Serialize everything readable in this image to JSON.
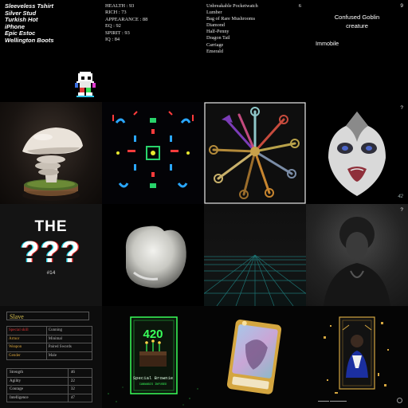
{
  "tiles": {
    "items": [
      "Sleeveless Tshirt",
      "Silver Stud",
      "Turkish Hot",
      "iPhone",
      "Epic Estoc",
      "Wellington Boots"
    ],
    "stats": [
      "HEALTH : 93",
      "RICH : 73",
      "APPEARANCE : 88",
      "EQ : 92",
      "SPIRIT : 93",
      "IQ : 84"
    ],
    "loot": {
      "number": "6",
      "items": [
        "Unbreakable Pocketwatch",
        "Lumber",
        "Bag of Rare Mushrooms",
        "Diamond",
        "Half-Penny",
        "Dragon Tail",
        "Carriage",
        "Emerald"
      ]
    },
    "goblin": {
      "number": "9",
      "name": "Confused Goblin",
      "type": "creature",
      "status": "Immobile"
    },
    "mask": {
      "top_number": "?",
      "bottom_number": "42"
    },
    "the": {
      "top": "THE",
      "marks": "???",
      "number": "#14"
    },
    "portrait": {
      "top_number": "?"
    },
    "card": {
      "title": "Slave",
      "attributes": [
        {
          "label": "Special skill",
          "value": "Cunning"
        },
        {
          "label": "Armor",
          "value": "Minimal"
        },
        {
          "label": "Weapon",
          "value": "Paired Swords"
        },
        {
          "label": "Gender",
          "value": "Male"
        }
      ],
      "stats": [
        {
          "label": "Strength",
          "value": "46"
        },
        {
          "label": "Agility",
          "value": "22"
        },
        {
          "label": "Courage",
          "value": "32"
        },
        {
          "label": "Intelligence",
          "value": "47"
        }
      ]
    },
    "brownie": {
      "badge": "420",
      "name": "Special Brownie",
      "subtitle": "CANNABIS INFUSED"
    }
  },
  "colors": {
    "background": "#000000",
    "card_gold": "#d9c253",
    "card_red": "#dd3333",
    "neon_green": "#39ff5a",
    "holo_gold": "#d4a640"
  }
}
